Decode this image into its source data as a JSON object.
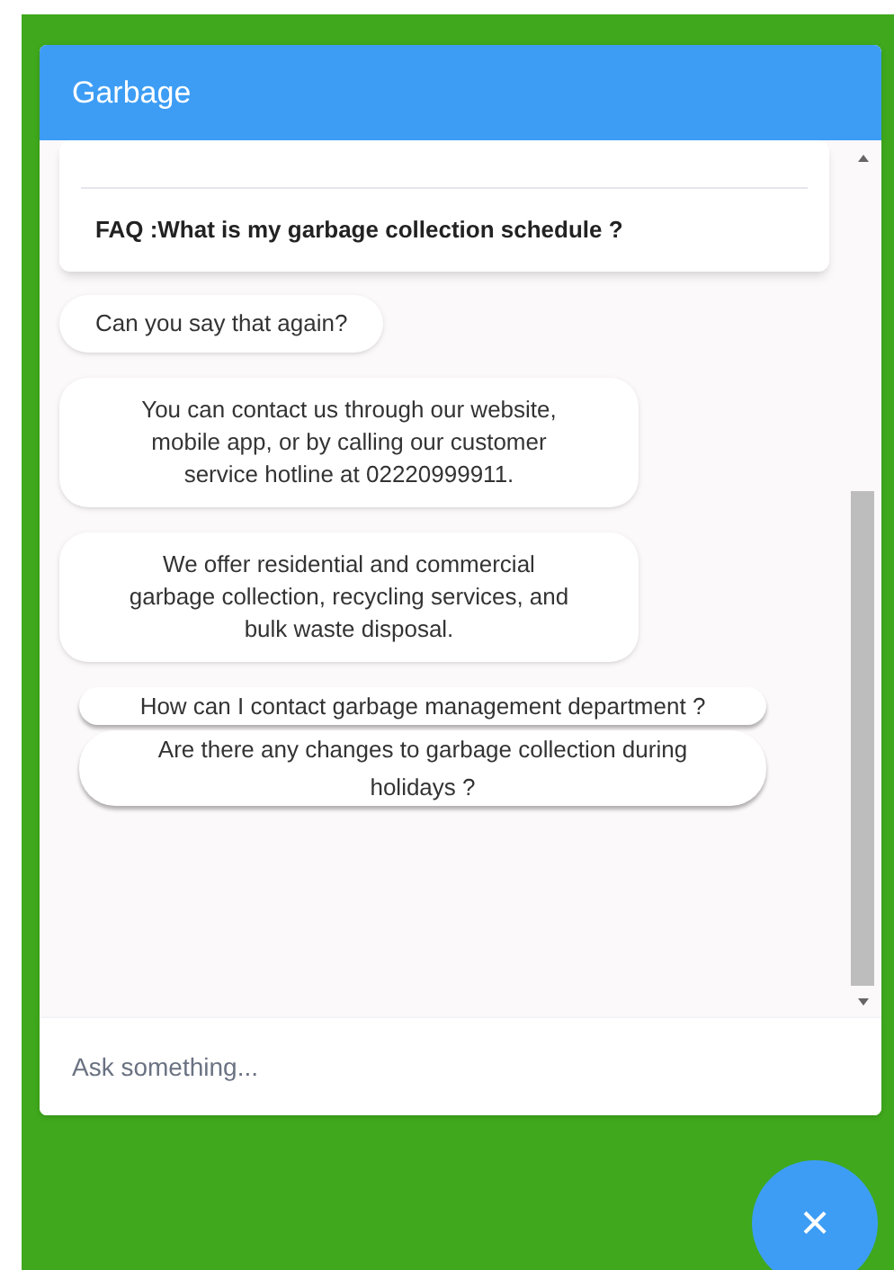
{
  "window": {
    "title": "Garbage"
  },
  "messages": [
    {
      "kind": "faq",
      "text": "FAQ :What is my garbage collection schedule ?"
    },
    {
      "kind": "bot",
      "text": "Can you say that again?"
    },
    {
      "kind": "bot",
      "text": "You can contact us through our website, mobile app, or by calling our customer service hotline at 02220999911."
    },
    {
      "kind": "bot",
      "text": "We offer residential and commercial garbage collection, recycling services, and bulk waste disposal."
    },
    {
      "kind": "suggestion",
      "text": "How can I contact garbage management department ?"
    },
    {
      "kind": "suggestion",
      "text": "Are there any changes to garbage collection during holidays ?"
    }
  ],
  "input": {
    "placeholder": "Ask something..."
  },
  "close_button": {
    "label": "×"
  }
}
